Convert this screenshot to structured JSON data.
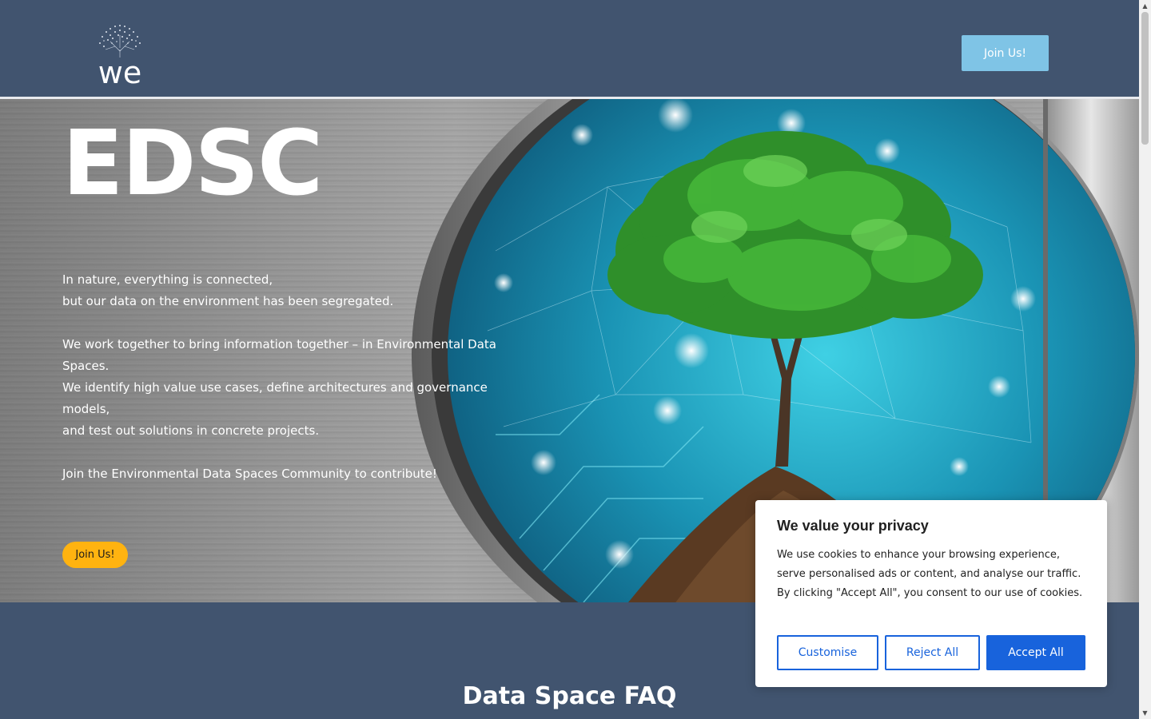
{
  "header": {
    "logo_text": "we",
    "join_label": "Join Us!"
  },
  "hero": {
    "title": "EDSC",
    "lines": [
      "In nature, everything is connected,",
      "but our data on the environment has been segregated.",
      "We work together to bring information together – in Environmental Data Spaces.",
      "We identify high value use cases, define architectures and governance models,",
      "and test out solutions in concrete projects.",
      "Join the Environmental Data Spaces Community to contribute!"
    ],
    "join_label": "Join Us!"
  },
  "faq": {
    "title": "Data Space FAQ"
  },
  "cookie": {
    "title": "We value your privacy",
    "text": "We use cookies to enhance your browsing experience, serve personalised ads or content, and analyse our traffic. By clicking \"Accept All\", you consent to our use of cookies.",
    "customise_label": "Customise",
    "reject_label": "Reject All",
    "accept_label": "Accept All"
  },
  "colors": {
    "header_bg": "#41546f",
    "header_button": "#7fc4e6",
    "hero_button": "#ffb310",
    "cookie_accent": "#1863dc"
  },
  "icons": {
    "scroll_up": "scroll-up-arrow-icon",
    "scroll_down": "scroll-down-arrow-icon"
  }
}
